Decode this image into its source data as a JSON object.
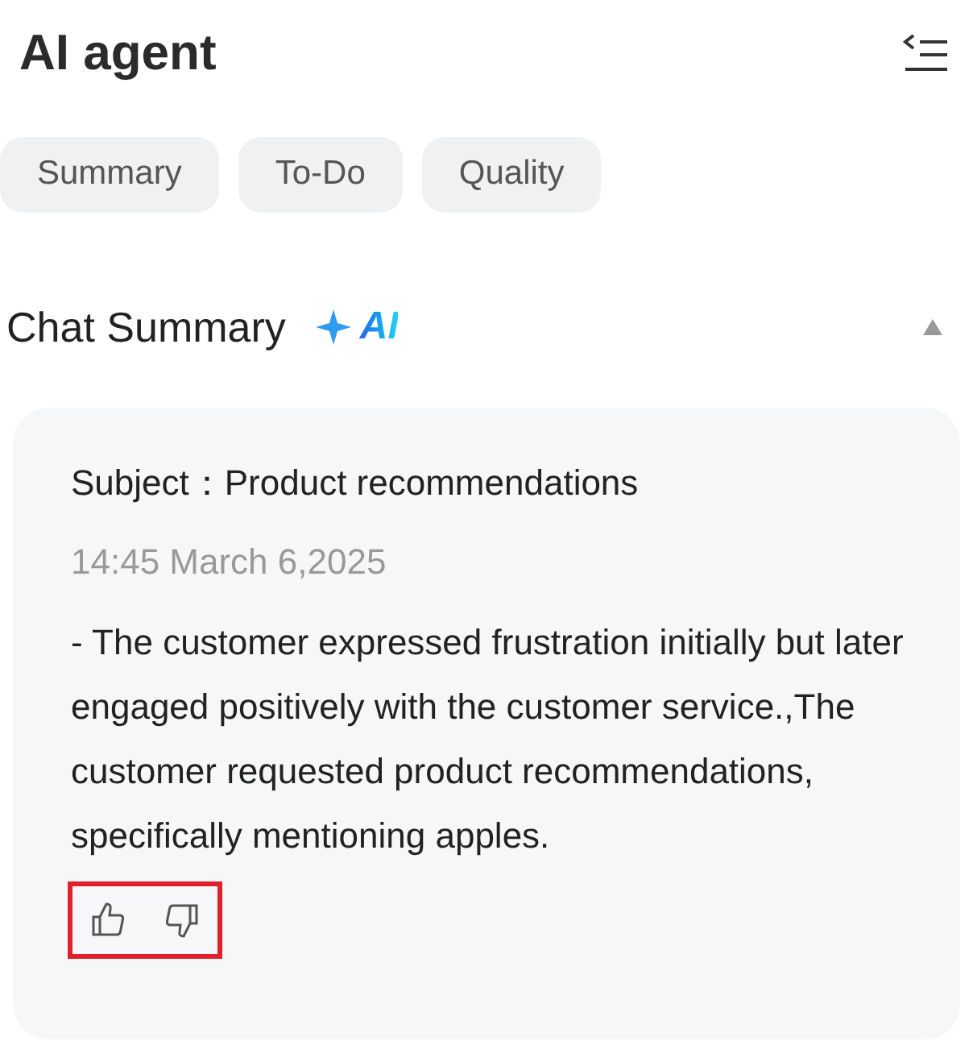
{
  "header": {
    "title": "AI agent"
  },
  "tabs": [
    {
      "label": "Summary"
    },
    {
      "label": "To-Do"
    },
    {
      "label": "Quality"
    }
  ],
  "section": {
    "title": "Chat Summary",
    "badge": "AI",
    "expanded": true
  },
  "summary": {
    "subject_label": "Subject：",
    "subject": "Product recommendations",
    "time": "14:45 March 6,2025",
    "text": "- The customer expressed frustration initially but later engaged positively with the customer service.,The customer requested product recommendations, specifically mentioning apples.",
    "feedback_highlighted": true
  }
}
